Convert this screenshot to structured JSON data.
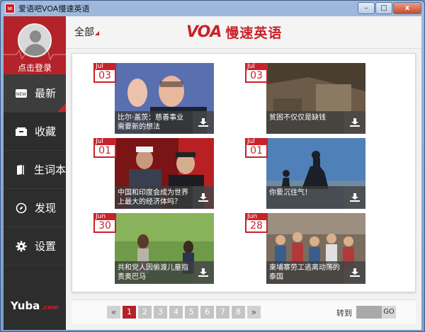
{
  "window": {
    "title": "爱语吧VOA慢速英语",
    "minimize": "–",
    "maximize": "□",
    "close": "x"
  },
  "sidebar": {
    "login": "点击登录",
    "items": [
      {
        "label": "最新",
        "icon": "news-icon",
        "active": true
      },
      {
        "label": "收藏",
        "icon": "inbox-icon",
        "active": false
      },
      {
        "label": "生词本",
        "icon": "book-icon",
        "active": false
      },
      {
        "label": "发现",
        "icon": "compass-icon",
        "active": false
      },
      {
        "label": "设置",
        "icon": "gear-icon",
        "active": false
      }
    ],
    "brand": "Yuba",
    "brand_suffix": ".com"
  },
  "header": {
    "filter": "全部",
    "logo": "VOA",
    "brand_name": "慢速英语"
  },
  "articles": [
    {
      "month": "Jul",
      "day": "03",
      "title": "比尔·盖茨：慈善事业需要新的想法"
    },
    {
      "month": "Jul",
      "day": "03",
      "title": "贫困不仅仅是缺钱"
    },
    {
      "month": "Jul",
      "day": "01",
      "title": "中国和印度会成为世界上最大的经济体吗？"
    },
    {
      "month": "Jul",
      "day": "01",
      "title": "你要沉住气！"
    },
    {
      "month": "Jun",
      "day": "30",
      "title": "共和党人因偷渡儿童指责奥巴马"
    },
    {
      "month": "Jun",
      "day": "28",
      "title": "柬埔寨劳工逃离动荡的泰国"
    }
  ],
  "pager": {
    "prev": "«",
    "pages": [
      "1",
      "2",
      "3",
      "4",
      "5",
      "6",
      "7",
      "8"
    ],
    "next": "»",
    "goto_label": "转到",
    "go": "GO"
  }
}
